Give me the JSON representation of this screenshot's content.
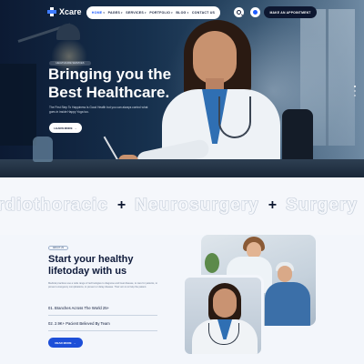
{
  "nav": {
    "logo": "Xcare",
    "menu": [
      {
        "label": "HOME",
        "active": true
      },
      {
        "label": "PAGES",
        "active": false
      },
      {
        "label": "SERVICES",
        "active": false
      },
      {
        "label": "PORTFOLIO",
        "active": false
      },
      {
        "label": "BLOG",
        "active": false
      },
      {
        "label": "CONTACT US",
        "active": false
      }
    ],
    "appointment_button": "MAKE AN APPOINTMENT"
  },
  "hero": {
    "eyebrow": "HEALTHCARE SERVICES",
    "title_line1": "Bringing you the",
    "title_line2": "Best Healthcare.",
    "description": "The First Step To Happiness Is Good Health but you can always control what goes in inside Happy Yoga too.",
    "button": "LEARN MORE",
    "slider_dots": 3,
    "active_dot": 0
  },
  "marquee": {
    "words": [
      "rdiothoracic",
      "Neurosurgery",
      "Surgery"
    ],
    "separator": "+"
  },
  "about": {
    "eyebrow": "ABOUT US",
    "title_line1": "Start your healthy",
    "title_line2": "lifetoday with us",
    "description": "Medical practices use a wide range of technologies to diagnose and treat disease, to care for patients, to prevent emergency complications, to prevent or delay disease. Their aim is to help the patient.",
    "stats": [
      {
        "label": "01. Branches Across The World 25+"
      },
      {
        "label": "02. 2.9K+ Pacient Believed By Team"
      }
    ],
    "button": "READ MORE"
  },
  "colors": {
    "accent": "#1d4fd8",
    "nav_dark": "#0d1730",
    "hero_bg": "#0c1a33"
  }
}
